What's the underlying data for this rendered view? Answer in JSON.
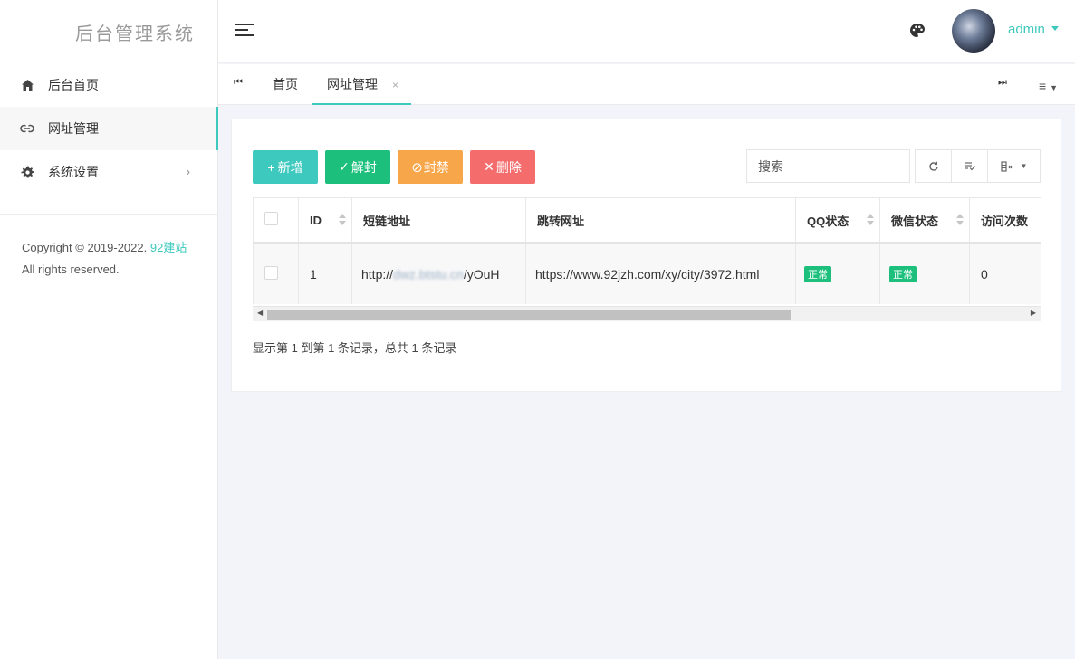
{
  "brand": "后台管理系统",
  "sidebar": {
    "items": [
      {
        "label": "后台首页",
        "icon": "home-icon"
      },
      {
        "label": "网址管理",
        "icon": "link-icon",
        "active": true
      },
      {
        "label": "系统设置",
        "icon": "gear-icon",
        "arrow": "›"
      }
    ],
    "footer": {
      "prefix": "Copyright © 2019-2022.",
      "link": "92建站",
      "suffix": "All rights reserved."
    }
  },
  "header": {
    "username": "admin"
  },
  "tabs": {
    "items": [
      {
        "label": "首页"
      },
      {
        "label": "网址管理",
        "close": "×",
        "active": true
      }
    ]
  },
  "toolbar": {
    "add": "新增",
    "add_glyph": "+",
    "unban": "解封",
    "unban_glyph": "✓",
    "ban": "封禁",
    "ban_glyph": "⊘",
    "delete": "删除",
    "delete_glyph": "✕",
    "search_placeholder": "搜索"
  },
  "table": {
    "columns": [
      "ID",
      "短链地址",
      "跳转网址",
      "QQ状态",
      "微信状态",
      "访问次数"
    ],
    "rows": [
      {
        "id": "1",
        "short_prefix": "http://",
        "short_blur": "dwz.btstu.cn",
        "short_suffix": "/yOuH",
        "url": "https://www.92jzh.com/xy/city/3972.html",
        "qq_status": "正常",
        "wx_status": "正常",
        "visits": "0"
      }
    ]
  },
  "pagination": {
    "summary": "显示第 1 到第 1 条记录，总共 1 条记录"
  },
  "colors": {
    "accent": "#3ec9be",
    "success": "#1cc07c",
    "warning": "#f8a64a",
    "danger": "#f56c6c"
  }
}
